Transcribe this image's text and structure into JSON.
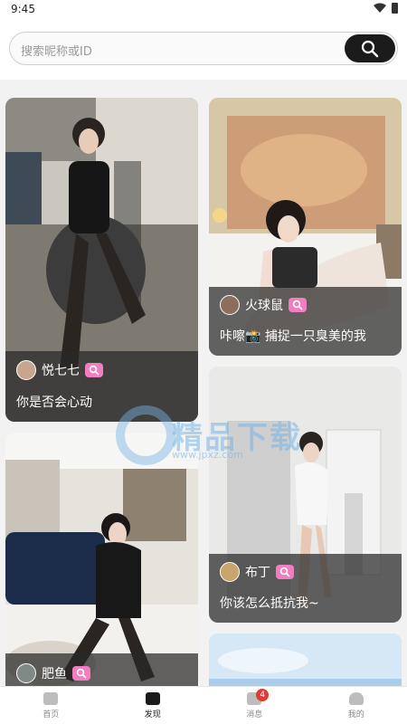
{
  "status": {
    "time": "9:45"
  },
  "search": {
    "placeholder": "搜索昵称或ID"
  },
  "cards": [
    {
      "username": "悦七七",
      "caption": "你是否会心动"
    },
    {
      "username": "火球鼠",
      "caption": "咔嚓📸 捕捉一只臭美的我"
    },
    {
      "username": "布丁",
      "caption": "你该怎么抵抗我~"
    },
    {
      "username": "肥鱼",
      "caption": ""
    }
  ],
  "watermark": {
    "text": "精品下载",
    "url": "www.jpxz.com"
  },
  "tabs": [
    {
      "label": "首页",
      "icon": "home-icon"
    },
    {
      "label": "发现",
      "icon": "discover-icon",
      "active": true
    },
    {
      "label": "消息",
      "icon": "message-icon",
      "badge": "4"
    },
    {
      "label": "我的",
      "icon": "profile-icon"
    }
  ],
  "colors": {
    "accent": "#1b1b1b",
    "badge": "#f07ec0",
    "notification": "#e53935"
  }
}
